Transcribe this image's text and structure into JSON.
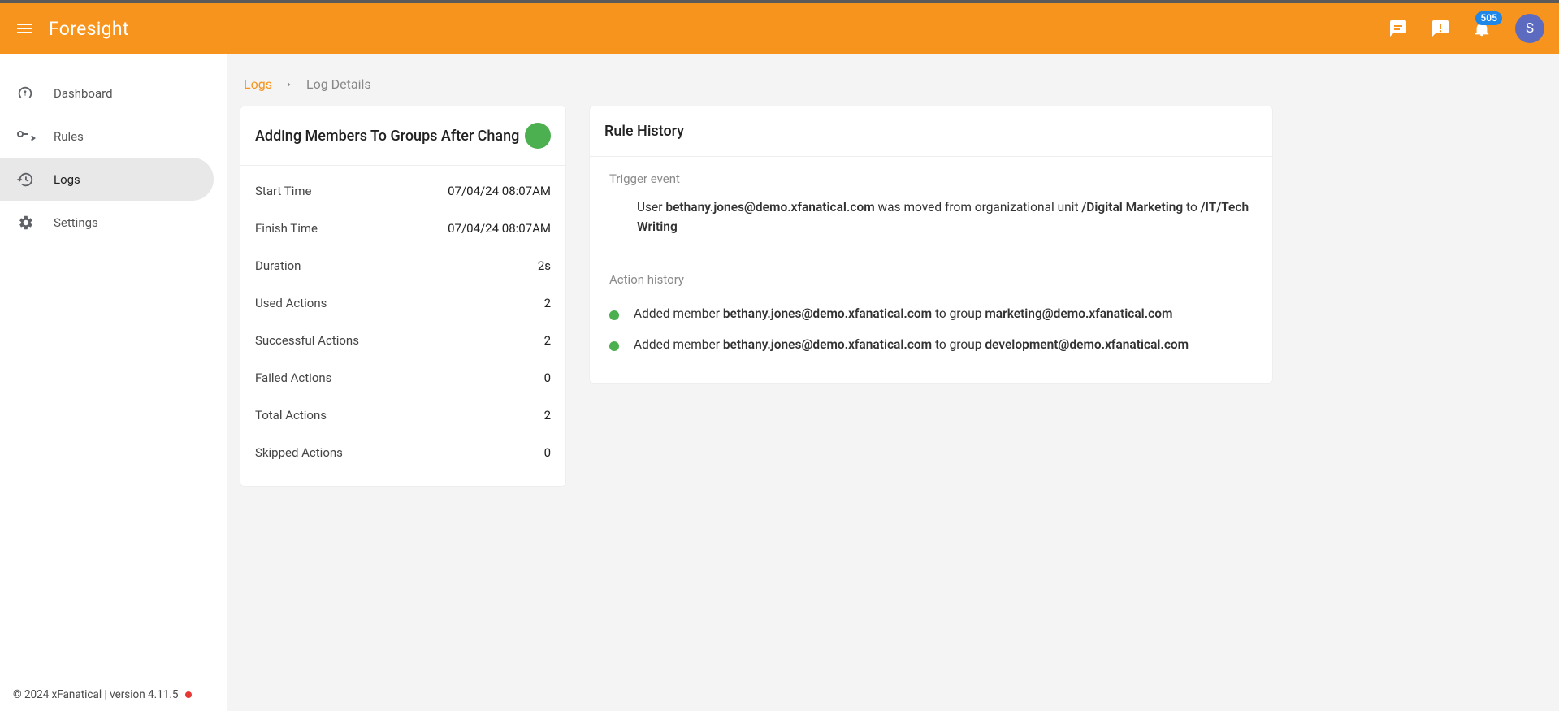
{
  "header": {
    "brand": "Foresight",
    "notif_badge": "505",
    "avatar_letter": "S"
  },
  "sidebar": {
    "items": [
      {
        "id": "dashboard",
        "label": "Dashboard"
      },
      {
        "id": "rules",
        "label": "Rules"
      },
      {
        "id": "logs",
        "label": "Logs"
      },
      {
        "id": "settings",
        "label": "Settings"
      }
    ],
    "footer": "© 2024 xFanatical | version 4.11.5"
  },
  "breadcrumb": {
    "root": "Logs",
    "current": "Log Details"
  },
  "summary": {
    "title": "Adding Members To Groups After Changin",
    "status_color": "#4caf50",
    "rows": {
      "start_time_label": "Start Time",
      "start_time_value": "07/04/24 08:07AM",
      "finish_time_label": "Finish Time",
      "finish_time_value": "07/04/24 08:07AM",
      "duration_label": "Duration",
      "duration_value": "2s",
      "used_label": "Used Actions",
      "used_value": "2",
      "successful_label": "Successful Actions",
      "successful_value": "2",
      "failed_label": "Failed Actions",
      "failed_value": "0",
      "total_label": "Total Actions",
      "total_value": "2",
      "skipped_label": "Skipped Actions",
      "skipped_value": "0"
    }
  },
  "history": {
    "title": "Rule History",
    "trigger_label": "Trigger event",
    "trigger_prefix": "User ",
    "trigger_user": "bethany.jones@demo.xfanatical.com",
    "trigger_mid": " was moved from organizational unit ",
    "trigger_ou_from": "/Digital Marketing",
    "trigger_to_word": " to ",
    "trigger_ou_to": "/IT/Tech Writing",
    "action_label": "Action history",
    "actions": [
      {
        "prefix": "Added member ",
        "member": "bethany.jones@demo.xfanatical.com",
        "mid": " to group ",
        "group": "marketing@demo.xfanatical.com"
      },
      {
        "prefix": "Added member ",
        "member": "bethany.jones@demo.xfanatical.com",
        "mid": " to group ",
        "group": "development@demo.xfanatical.com"
      }
    ]
  }
}
